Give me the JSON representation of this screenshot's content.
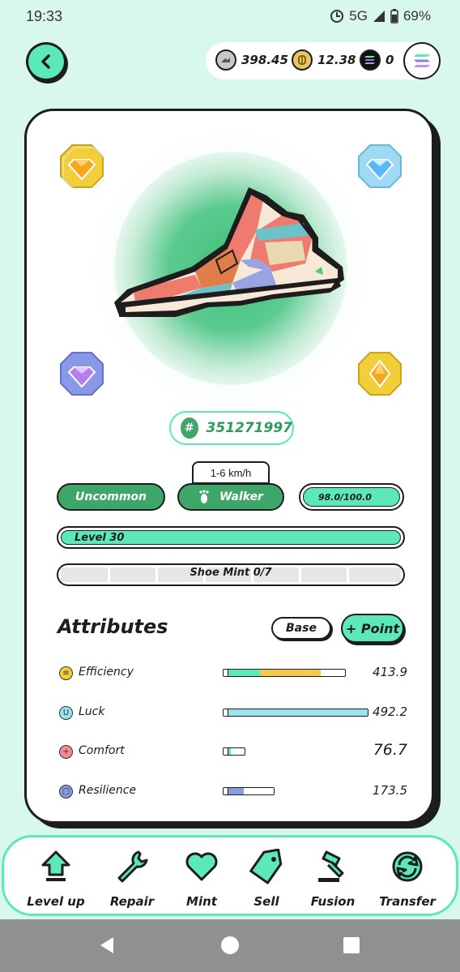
{
  "status_bar": {
    "time": "19:33",
    "network": "5G",
    "battery": "69%"
  },
  "wallet": {
    "items": [
      {
        "icon": "gst-coin-icon",
        "value": "398.45"
      },
      {
        "icon": "gmt-coin-icon",
        "value": "12.38"
      },
      {
        "icon": "sol-coin-icon",
        "value": "0"
      }
    ],
    "chain_icon": "solana-logo-icon"
  },
  "sneaker": {
    "id": "351271997",
    "speed_range": "1-6 km/h",
    "quality": "Uncommon",
    "type": "Walker",
    "durability": "98.0/100.0",
    "durability_fraction": 0.98,
    "level": "Level 30",
    "level_fraction": 1.0,
    "shoe_mint": "Shoe Mint 0/7",
    "gem_sockets": [
      "yellow-gem-icon",
      "blue-gem-icon",
      "purple-gem-icon",
      "yellow-gem-icon"
    ]
  },
  "attributes": {
    "title": "Attributes",
    "base_label": "Base",
    "point_label": "+ Point",
    "rows": [
      {
        "name": "Efficiency",
        "value": "413.9",
        "base_fraction": 0.27,
        "bonus_fraction": 0.52,
        "color": "#f2c94c",
        "base_color": "#5de8bc"
      },
      {
        "name": "Luck",
        "value": "492.2",
        "base_fraction": 0.0,
        "bonus_fraction": 1.0,
        "color": "#9ce3f0",
        "base_color": "#9ce3f0"
      },
      {
        "name": "Comfort",
        "value": "76.7",
        "base_fraction": 0.15,
        "bonus_fraction": 0.0,
        "color": "#5de8bc",
        "base_color": "#5de8bc"
      },
      {
        "name": "Resilience",
        "value": "173.5",
        "base_fraction": 0.0,
        "bonus_fraction": 0.34,
        "color": "#8b9be0",
        "base_color": "#8b9be0"
      }
    ]
  },
  "bottom_nav": [
    {
      "label": "Level up",
      "icon": "level-up-arrow-icon"
    },
    {
      "label": "Repair",
      "icon": "wrench-icon"
    },
    {
      "label": "Mint",
      "icon": "heart-icon"
    },
    {
      "label": "Sell",
      "icon": "price-tag-icon"
    },
    {
      "label": "Fusion",
      "icon": "hammer-icon"
    },
    {
      "label": "Transfer",
      "icon": "transfer-arrows-icon"
    }
  ]
}
